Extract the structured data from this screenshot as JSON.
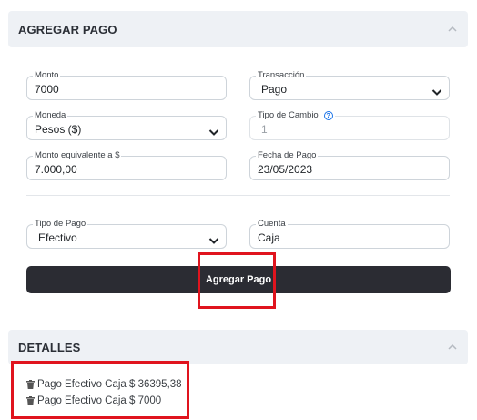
{
  "agregar_pago": {
    "title": "AGREGAR PAGO",
    "monto": {
      "label": "Monto",
      "value": "7000"
    },
    "transaccion": {
      "label": "Transacción",
      "value": "Pago"
    },
    "moneda": {
      "label": "Moneda",
      "value": "Pesos ($)"
    },
    "tipo_cambio": {
      "label": "Tipo de Cambio",
      "value": "1"
    },
    "monto_equivalente": {
      "label": "Monto equivalente a $",
      "value": "7.000,00"
    },
    "fecha_pago": {
      "label": "Fecha de Pago",
      "value": "23/05/2023"
    },
    "tipo_pago": {
      "label": "Tipo de Pago",
      "value": "Efectivo"
    },
    "cuenta": {
      "label": "Cuenta",
      "value": "Caja"
    },
    "submit_label": "Agregar Pago"
  },
  "detalles": {
    "title": "DETALLES",
    "items": [
      {
        "text": "Pago Efectivo Caja $ 36395,38"
      },
      {
        "text": "Pago Efectivo Caja $ 7000"
      }
    ]
  },
  "colors": {
    "header_bg": "#eef1f5",
    "button_bg": "#2b2c33",
    "highlight": "#e0141e",
    "help_blue": "#1a73e8"
  },
  "icons": [
    "chevron-up-icon",
    "chevron-down-icon",
    "question-circle-icon",
    "trash-icon"
  ]
}
